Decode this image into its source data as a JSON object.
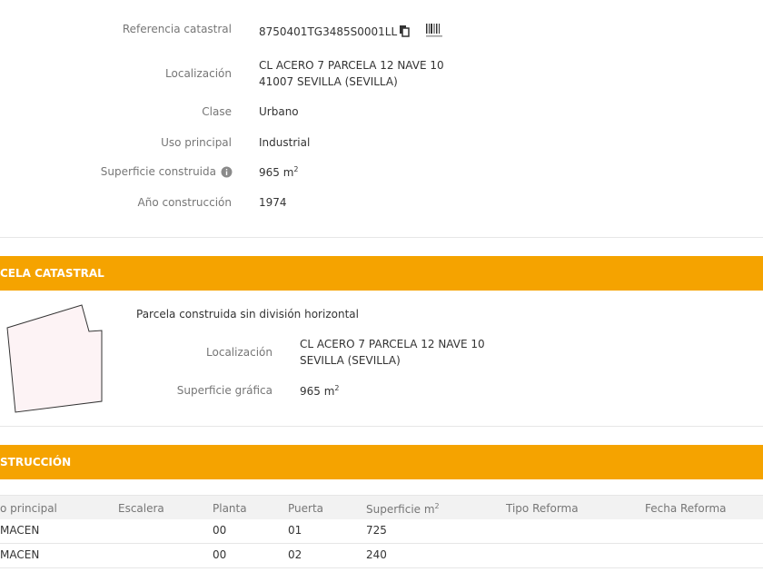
{
  "datos": {
    "referencia_label": "Referencia catastral",
    "referencia_value": "8750401TG3485S0001LL",
    "localizacion_label": "Localización",
    "localizacion_line1": "CL ACERO 7 PARCELA 12 NAVE 10",
    "localizacion_line2": "41007 SEVILLA (SEVILLA)",
    "clase_label": "Clase",
    "clase_value": "Urbano",
    "uso_label": "Uso principal",
    "uso_value": "Industrial",
    "superficie_label": "Superficie construida",
    "superficie_value": "965 m",
    "anio_label": "Año construcción",
    "anio_value": "1974"
  },
  "parcela": {
    "header": "CELA CATASTRAL",
    "descripcion": "Parcela construida sin división horizontal",
    "localizacion_label": "Localización",
    "localizacion_line1": "CL ACERO 7 PARCELA 12 NAVE 10",
    "localizacion_line2": "SEVILLA (SEVILLA)",
    "superficie_label": "Superficie gráfica",
    "superficie_value": "965 m"
  },
  "construccion": {
    "header": "STRUCCIÓN",
    "columns": [
      "o principal",
      "Escalera",
      "Planta",
      "Puerta",
      "Superficie m",
      "Tipo Reforma",
      "Fecha Reforma"
    ],
    "rows": [
      {
        "uso": "MACEN",
        "escalera": "",
        "planta": "00",
        "puerta": "01",
        "superficie": "725",
        "tipo": "",
        "fecha": ""
      },
      {
        "uso": "MACEN",
        "escalera": "",
        "planta": "00",
        "puerta": "02",
        "superficie": "240",
        "tipo": "",
        "fecha": ""
      }
    ]
  },
  "icons": {
    "copy": "copy-icon",
    "barcode": "barcode-icon",
    "info": "info-icon"
  },
  "colors": {
    "accent": "#f5a300",
    "label": "#767676",
    "text": "#333333",
    "parcel_fill": "#fdf3f5"
  }
}
